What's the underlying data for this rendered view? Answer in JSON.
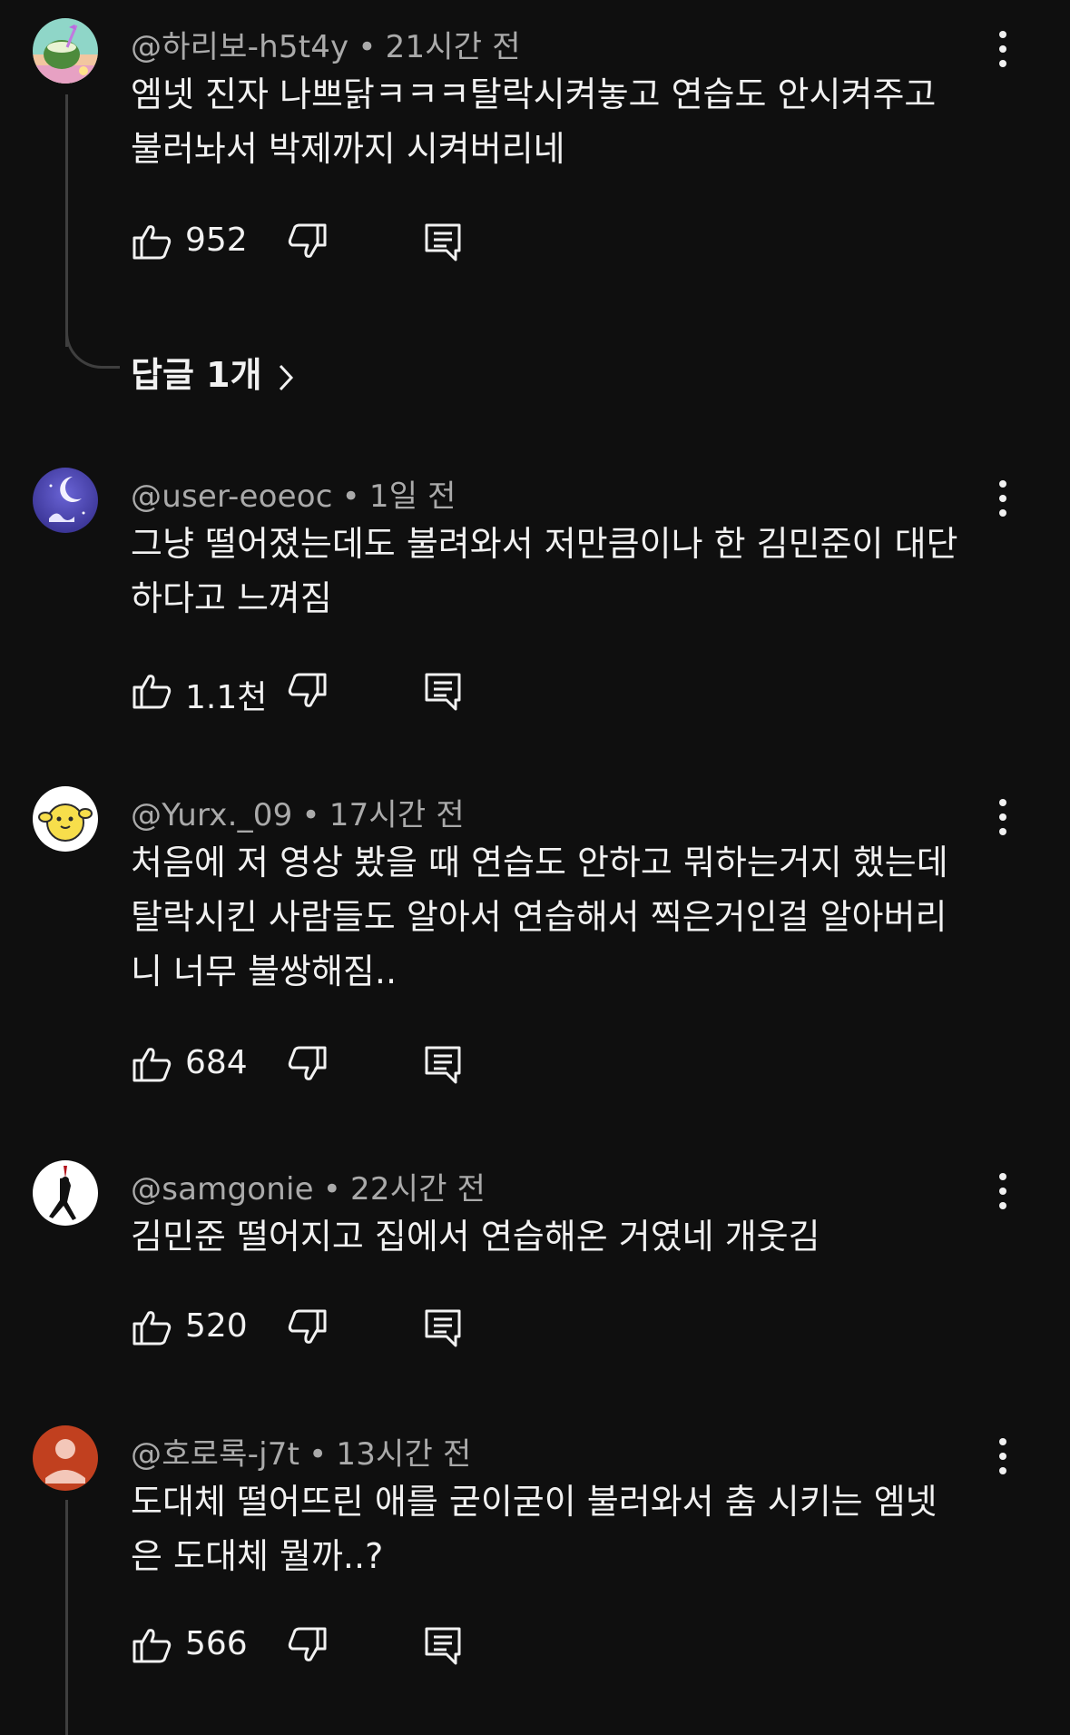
{
  "comments": [
    {
      "handle": "@하리보-h5t4y",
      "time": "21시간 전",
      "lines": [
        "엠넷 진자 나쁘닭ㅋㅋㅋ탈락시켜놓고 연습도 안시켜주고",
        "불러놔서 박제까지 시켜버리네"
      ],
      "likes": "952",
      "avatar": "avatar-coconut-drink"
    },
    {
      "handle": "@user-eoeoc",
      "time": "1일 전",
      "lines": [
        "그냥 떨어졌는데도 불려와서 저만큼이나 한 김민준이 대단",
        "하다고 느껴짐"
      ],
      "likes": "1.1천",
      "avatar": "avatar-night-moon"
    },
    {
      "handle": "@Yurx._09",
      "time": "17시간 전",
      "lines": [
        "처음에 저 영상 봤을 때 연습도 안하고 뭐하는거지 했는데",
        "탈락시킨 사람들도 알아서 연습해서 찍은거인걸 알아버리",
        "니 너무 불쌍해짐.."
      ],
      "likes": "684",
      "avatar": "avatar-yellow-bear"
    },
    {
      "handle": "@samgonie",
      "time": "22시간 전",
      "lines": [
        "김민준 떨어지고 집에서 연습해온 거였네 개웃김"
      ],
      "likes": "520",
      "avatar": "avatar-dancer"
    },
    {
      "handle": "@호로록-j7t",
      "time": "13시간 전",
      "lines": [
        "도대체 떨어뜨린 애를 굳이굳이 불러와서 춤 시키는 엠넷",
        "은 도대체 뭘까..?"
      ],
      "likes": "566",
      "avatar": "avatar-default-person"
    }
  ],
  "replies_label": "답글 1개",
  "colors": {
    "background": "#0f0f0f",
    "text": "#f1f1f1",
    "meta": "#aaaaaa",
    "default_avatar": "#c1401f"
  },
  "icons": {
    "like": "thumbs-up-icon",
    "dislike": "thumbs-down-icon",
    "reply": "comment-reply-icon",
    "menu": "more-vertical-icon",
    "chevron": "chevron-right-icon"
  }
}
